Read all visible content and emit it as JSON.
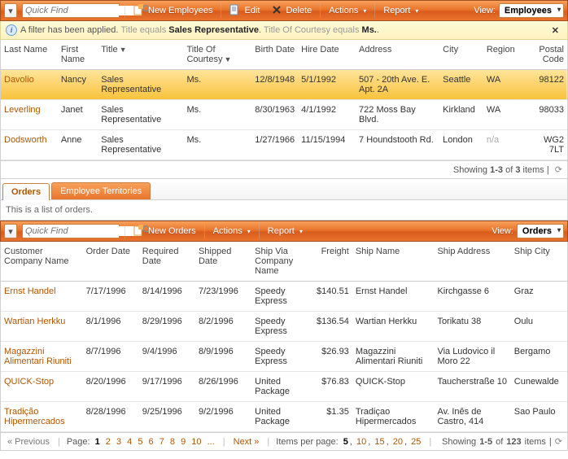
{
  "toolbar1": {
    "quick_find_ph": "Quick Find",
    "new_label": "New Employees",
    "edit_label": "Edit",
    "delete_label": "Delete",
    "actions_label": "Actions",
    "report_label": "Report",
    "view_label": "View:",
    "view_value": "Employees"
  },
  "filter_bar": {
    "prefix": "A filter has been applied.",
    "field1": "Title",
    "op1": "equals",
    "val1": "Sales Representative",
    "sep1": ".",
    "field2": "Title Of Courtesy",
    "op2": "equals",
    "val2": "Ms.",
    "sep2": "."
  },
  "emp_cols": {
    "last_name": "Last Name",
    "first_name": "First Name",
    "title": "Title",
    "toc": "Title Of Courtesy",
    "birth": "Birth Date",
    "hire": "Hire Date",
    "address": "Address",
    "city": "City",
    "region": "Region",
    "postal": "Postal Code"
  },
  "employees": [
    {
      "last_name": "Davolio",
      "first_name": "Nancy",
      "title": "Sales Representative",
      "toc": "Ms.",
      "birth": "12/8/1948",
      "hire": "5/1/1992",
      "address": "507 - 20th Ave. E. Apt. 2A",
      "city": "Seattle",
      "region": "WA",
      "postal": "98122",
      "selected": true
    },
    {
      "last_name": "Leverling",
      "first_name": "Janet",
      "title": "Sales Representative",
      "toc": "Ms.",
      "birth": "8/30/1963",
      "hire": "4/1/1992",
      "address": "722 Moss Bay Blvd.",
      "city": "Kirkland",
      "region": "WA",
      "postal": "98033"
    },
    {
      "last_name": "Dodsworth",
      "first_name": "Anne",
      "title": "Sales Representative",
      "toc": "Ms.",
      "birth": "1/27/1966",
      "hire": "11/15/1994",
      "address": "7 Houndstooth Rd.",
      "city": "London",
      "region": "n/a",
      "postal": "WG2 7LT"
    }
  ],
  "emp_footer": {
    "showing_pre": "Showing ",
    "showing_bold": "1-3",
    "showing_mid": " of ",
    "showing_total": "3",
    "showing_post": " items"
  },
  "tabs": {
    "orders": "Orders",
    "territories": "Employee Territories"
  },
  "tab_body_text": "This is a list of orders.",
  "toolbar2": {
    "quick_find_ph": "Quick Find",
    "new_label": "New Orders",
    "actions_label": "Actions",
    "report_label": "Report",
    "view_label": "View:",
    "view_value": "Orders"
  },
  "ord_cols": {
    "company": "Customer Company Name",
    "order_date": "Order Date",
    "required": "Required Date",
    "shipped": "Shipped Date",
    "shipvia": "Ship Via Company Name",
    "freight": "Freight",
    "ship_name": "Ship Name",
    "ship_addr": "Ship Address",
    "ship_city": "Ship City"
  },
  "orders": [
    {
      "company": "Ernst Handel",
      "order_date": "7/17/1996",
      "required": "8/14/1996",
      "shipped": "7/23/1996",
      "shipvia": "Speedy Express",
      "freight": "$140.51",
      "ship_name": "Ernst Handel",
      "ship_addr": "Kirchgasse 6",
      "ship_city": "Graz"
    },
    {
      "company": "Wartian Herkku",
      "order_date": "8/1/1996",
      "required": "8/29/1996",
      "shipped": "8/2/1996",
      "shipvia": "Speedy Express",
      "freight": "$136.54",
      "ship_name": "Wartian Herkku",
      "ship_addr": "Torikatu 38",
      "ship_city": "Oulu"
    },
    {
      "company": "Magazzini Alimentari Riuniti",
      "order_date": "8/7/1996",
      "required": "9/4/1996",
      "shipped": "8/9/1996",
      "shipvia": "Speedy Express",
      "freight": "$26.93",
      "ship_name": "Magazzini Alimentari Riuniti",
      "ship_addr": "Via Ludovico il Moro 22",
      "ship_city": "Bergamo"
    },
    {
      "company": "QUICK-Stop",
      "order_date": "8/20/1996",
      "required": "9/17/1996",
      "shipped": "8/26/1996",
      "shipvia": "United Package",
      "freight": "$76.83",
      "ship_name": "QUICK-Stop",
      "ship_addr": "Taucherstraße 10",
      "ship_city": "Cunewalde"
    },
    {
      "company": "Tradição Hipermercados",
      "order_date": "8/28/1996",
      "required": "9/25/1996",
      "shipped": "9/2/1996",
      "shipvia": "United Package",
      "freight": "$1.35",
      "ship_name": "Tradiçao Hipermercados",
      "ship_addr": "Av. Inês de Castro, 414",
      "ship_city": "Sao Paulo"
    }
  ],
  "pager": {
    "prev": "« Previous",
    "page_label": "Page:",
    "pages": [
      "1",
      "2",
      "3",
      "4",
      "5",
      "6",
      "7",
      "8",
      "9",
      "10",
      "..."
    ],
    "current_page": "1",
    "next": "Next »",
    "items_per_page_label": "Items per page:",
    "ipp_options": [
      "5",
      "10",
      "15",
      "20",
      "25"
    ],
    "ipp_current": "5",
    "showing_pre": "Showing ",
    "showing_bold": "1-5",
    "showing_mid": " of ",
    "showing_total": "123",
    "showing_post": " items"
  }
}
